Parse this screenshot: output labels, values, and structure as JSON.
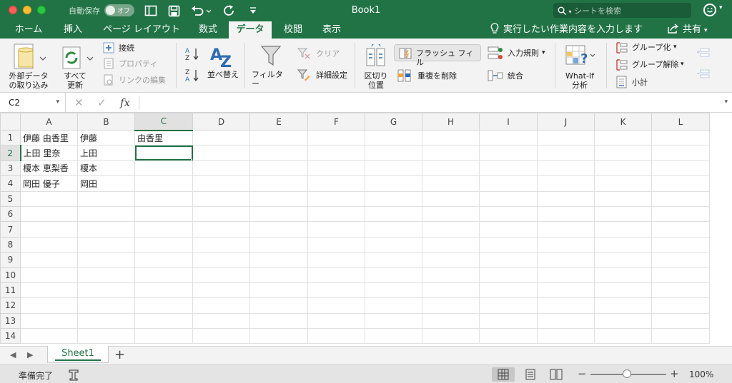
{
  "title_bar": {
    "autosave_label": "自動保存",
    "autosave_state": "オフ",
    "document_title": "Book1",
    "search_placeholder": "シートを検索"
  },
  "tabs": [
    "ホーム",
    "挿入",
    "ページ レイアウト",
    "数式",
    "データ",
    "校閲",
    "表示"
  ],
  "active_tab": "データ",
  "tell_me": "実行したい作業内容を入力します",
  "share": "共有",
  "ribbon": {
    "external_data": "外部データ\nの取り込み",
    "refresh_all": "すべて\n更新",
    "connections": "接続",
    "properties": "プロパティ",
    "edit_links": "リンクの編集",
    "sort": "並べ替え",
    "filter": "フィルター",
    "clear": "クリア",
    "advanced": "詳細設定",
    "text_to_columns": "区切り\n位置",
    "flash_fill": "フラッシュ フィル",
    "remove_duplicates": "重複を削除",
    "data_validation": "入力規則",
    "consolidate": "統合",
    "whatif": "What-If\n分析",
    "group": "グループ化",
    "ungroup": "グループ解除",
    "subtotal": "小計"
  },
  "formula_bar": {
    "name_box": "C2",
    "formula": "",
    "fx": "fx"
  },
  "columns": [
    "A",
    "B",
    "C",
    "D",
    "E",
    "F",
    "G",
    "H",
    "I",
    "J",
    "K",
    "L"
  ],
  "rows": [
    [
      "伊藤 由香里",
      "伊藤",
      "由香里"
    ],
    [
      "上田 里奈",
      "上田",
      ""
    ],
    [
      "榎本 恵梨香",
      "榎本",
      ""
    ],
    [
      "岡田 優子",
      "岡田",
      ""
    ],
    [],
    [],
    [],
    [],
    [],
    [],
    [],
    [],
    [],
    []
  ],
  "active_cell": {
    "row": 2,
    "col": "C"
  },
  "sheet_tabs": [
    "Sheet1"
  ],
  "status": {
    "ready": "準備完了",
    "zoom": "100%"
  },
  "colors": {
    "accent": "#217346",
    "ribbon_bg": "#f3f3f3"
  }
}
